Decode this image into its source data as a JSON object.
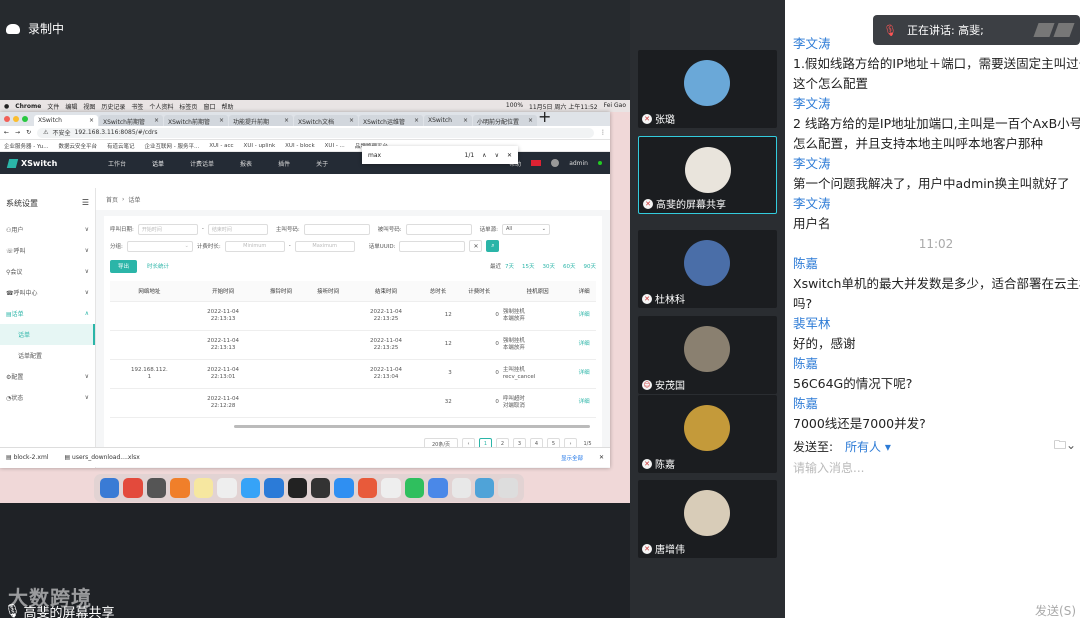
{
  "recording": {
    "label": "录制中"
  },
  "watermark": "大数跨境",
  "sharer_label": "高斐的屏幕共享",
  "mac_menubar": {
    "items": [
      "Chrome",
      "文件",
      "编辑",
      "视图",
      "历史记录",
      "书签",
      "个人资料",
      "标签页",
      "窗口",
      "帮助"
    ],
    "right": "11月5日 周六 上午11:52",
    "user": "Fei Gao",
    "battery": "100%"
  },
  "browser": {
    "tabs": [
      "XSwitch",
      "XSwitch前期管",
      "XSwitch前期管",
      "功能提升前期",
      "XSwitch文档",
      "XSwitch运维管",
      "XSwitch",
      "小明前分配位置"
    ],
    "url": "192.168.3.116:8085/#/cdrs",
    "secure_label": "不安全",
    "bookmarks": [
      "企业服务器 - Yu...",
      "数据云安全平台",
      "有道云笔记",
      "企业互联网 - 服务平...",
      "XUI - acc",
      "XUI - uplink",
      "XUI - block",
      "XUI - ...",
      "品牌管理平台"
    ],
    "find": {
      "query": "max",
      "count": "1/1"
    }
  },
  "app": {
    "brand": "XSwitch",
    "nav": [
      "工作台",
      "话单",
      "计费话单",
      "报表",
      "插件",
      "关于"
    ],
    "help": "帮助",
    "user": "admin",
    "sidebar_title": "系统设置",
    "sidebar": [
      {
        "label": "用户",
        "arrow": "∨"
      },
      {
        "label": "呼叫",
        "arrow": "∨"
      },
      {
        "label": "会议",
        "arrow": "∨"
      },
      {
        "label": "呼叫中心",
        "arrow": "∨"
      },
      {
        "label": "话单",
        "arrow": "∧"
      },
      {
        "label": "话单",
        "arrow": ""
      },
      {
        "label": "话单配置",
        "arrow": ""
      },
      {
        "label": "配置",
        "arrow": "∨"
      },
      {
        "label": "状态",
        "arrow": "∨"
      }
    ],
    "breadcrumb": [
      "首页",
      "话单"
    ],
    "filters": {
      "call_date_label": "呼叫日期:",
      "start_placeholder": "开始时间",
      "end_placeholder": "结束时间",
      "caller_label": "主叫号码:",
      "callee_label": "被叫号码:",
      "source_label": "话单源:",
      "source_value": "All",
      "group_label": "分组:",
      "billsec_label": "计费时长:",
      "min_placeholder": "Minimum",
      "max_placeholder": "Maximum",
      "uuid_label": "话单UUID:"
    },
    "export_label": "导出",
    "stats_label": "时长统计",
    "recent": {
      "label": "最近",
      "options": [
        "7天",
        "15天",
        "30天",
        "60天",
        "90天"
      ]
    },
    "table": {
      "headers": [
        "网络地址",
        "开始时间",
        "振铃时间",
        "接听时间",
        "结束时间",
        "总时长",
        "计费时长",
        "挂机原因",
        "详细"
      ],
      "rows": [
        {
          "ip": "",
          "start": "2022-11-04\n22:13:13",
          "ring": "",
          "answer": "",
          "end": "2022-11-04\n22:13:25",
          "dur": "12",
          "bill": "0",
          "cause": "强制挂机\n本端放弃",
          "detail": "详细"
        },
        {
          "ip": "",
          "start": "2022-11-04\n22:13:13",
          "ring": "",
          "answer": "",
          "end": "2022-11-04\n22:13:25",
          "dur": "12",
          "bill": "0",
          "cause": "强制挂机\n本端放弃",
          "detail": "详细"
        },
        {
          "ip": "192.168.112.\n1",
          "start": "2022-11-04\n22:13:01",
          "ring": "",
          "answer": "",
          "end": "2022-11-04\n22:13:04",
          "dur": "3",
          "bill": "0",
          "cause": "主叫挂机\nrecv_cancel",
          "detail": "详细"
        },
        {
          "ip": "",
          "start": "2022-11-04\n22:12:28",
          "ring": "",
          "answer": "",
          "end": "",
          "dur": "32",
          "bill": "0",
          "cause": "呼叫超时\n对端取消",
          "detail": "详细"
        }
      ]
    },
    "pager": {
      "size": "20条/页",
      "pages": [
        "1",
        "2",
        "3",
        "4",
        "5"
      ],
      "total": "1/5"
    }
  },
  "downloads": {
    "items": [
      "block-2.xml",
      "users_download....xlsx"
    ],
    "show_all": "显示全部"
  },
  "participants": [
    {
      "name": "张璐",
      "color": "#6aa8d8"
    },
    {
      "name": "高斐的屏幕共享",
      "color": "#e9e4dc"
    },
    {
      "name": "杜林科",
      "color": "#4a6ea8"
    },
    {
      "name": "安茂国",
      "color": "#8a8070"
    },
    {
      "name": "陈嘉",
      "color": "#c49a3a"
    },
    {
      "name": "唐增伟",
      "color": "#d8ccb8"
    }
  ],
  "speaking": {
    "label": "正在讲话: 高斐;"
  },
  "chat": {
    "messages": [
      {
        "sender": "李文涛",
        "lines": [
          "1.假如线路方给的IP地址＋端口，需要送固定主叫过去",
          "这个怎么配置"
        ]
      },
      {
        "sender": "李文涛",
        "lines": [
          "2 线路方给的是IP地址加端口,主叫是一百个AxB小号那",
          "怎么配置，并且支持本地主叫呼本地客户那种"
        ]
      },
      {
        "sender": "李文涛",
        "lines": [
          "第一个问题我解决了，用户中admin换主叫就好了"
        ]
      },
      {
        "sender": "李文涛",
        "lines": [
          "用户名"
        ]
      },
      {
        "time": "11:02"
      },
      {
        "sender": "陈嘉",
        "lines": [
          "Xswitch单机的最大并发数是多少，适合部署在云主机",
          "吗?"
        ]
      },
      {
        "sender": "裴军林",
        "lines": [
          "好的，感谢"
        ]
      },
      {
        "sender": "陈嘉",
        "lines": [
          "56C64G的情况下呢?"
        ]
      },
      {
        "sender": "陈嘉",
        "lines": [
          "7000线还是7000并发?"
        ]
      }
    ],
    "send_to_label": "发送至:",
    "send_to_value": "所有人",
    "input_placeholder": "请输入消息...",
    "send_button": "发送(S)"
  }
}
